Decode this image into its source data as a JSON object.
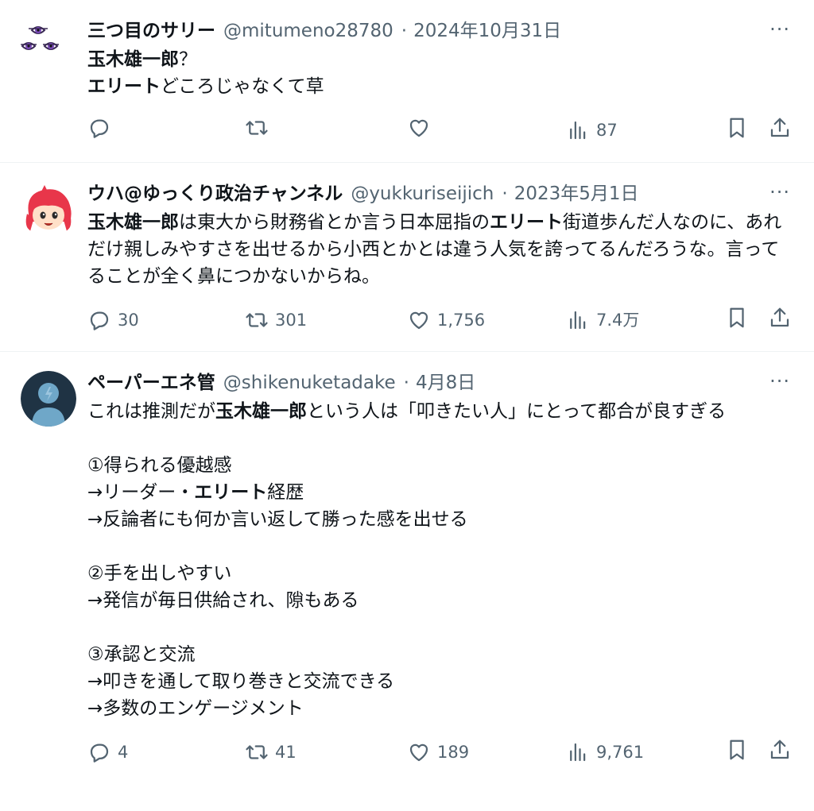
{
  "tweets": [
    {
      "name": "三つ目のサリー",
      "handle": "@mitumeno28780",
      "date": "2024年10月31日",
      "more": "···",
      "body_segments": [
        {
          "text": "玉木雄一郎",
          "bold": true
        },
        {
          "text": "？\n",
          "bold": false
        },
        {
          "text": "エリート",
          "bold": true
        },
        {
          "text": "どころじゃなくて草",
          "bold": false
        }
      ],
      "stats": {
        "replies": "",
        "retweets": "",
        "likes": "",
        "views": "87"
      }
    },
    {
      "name": "ウハ@ゆっくり政治チャンネル",
      "handle": "@yukkuriseijich",
      "date": "2023年5月1日",
      "more": "···",
      "body_segments": [
        {
          "text": "玉木雄一郎",
          "bold": true
        },
        {
          "text": "は東大から財務省とか言う日本屈指の",
          "bold": false
        },
        {
          "text": "エリート",
          "bold": true
        },
        {
          "text": "街道歩んだ人なのに、あれだけ親しみやすさを出せるから小西とかとは違う人気を誇ってるんだろうな。言ってることが全く鼻につかないからね。",
          "bold": false
        }
      ],
      "stats": {
        "replies": "30",
        "retweets": "301",
        "likes": "1,756",
        "views": "7.4万"
      }
    },
    {
      "name": "ペーパーエネ管",
      "handle": "@shikenuketadake",
      "date": "4月8日",
      "more": "···",
      "body_segments": [
        {
          "text": "これは推測だが",
          "bold": false
        },
        {
          "text": "玉木雄一郎",
          "bold": true
        },
        {
          "text": "という人は「叩きたい人」にとって都合が良すぎる\n\n①得られる優越感\n→リーダー・",
          "bold": false
        },
        {
          "text": "エリート",
          "bold": true
        },
        {
          "text": "経歴\n→反論者にも何か言い返して勝った感を出せる\n\n②手を出しやすい\n→発信が毎日供給され、隙もある\n\n③承認と交流\n→叩きを通して取り巻きと交流できる\n→多数のエンゲージメント",
          "bold": false
        }
      ],
      "stats": {
        "replies": "4",
        "retweets": "41",
        "likes": "189",
        "views": "9,761"
      }
    }
  ],
  "colors": {
    "text": "#0f1419",
    "secondary": "#536471",
    "divider": "#eff3f4"
  },
  "icons": [
    "reply-icon",
    "retweet-icon",
    "like-icon",
    "views-icon",
    "bookmark-icon",
    "share-icon"
  ]
}
